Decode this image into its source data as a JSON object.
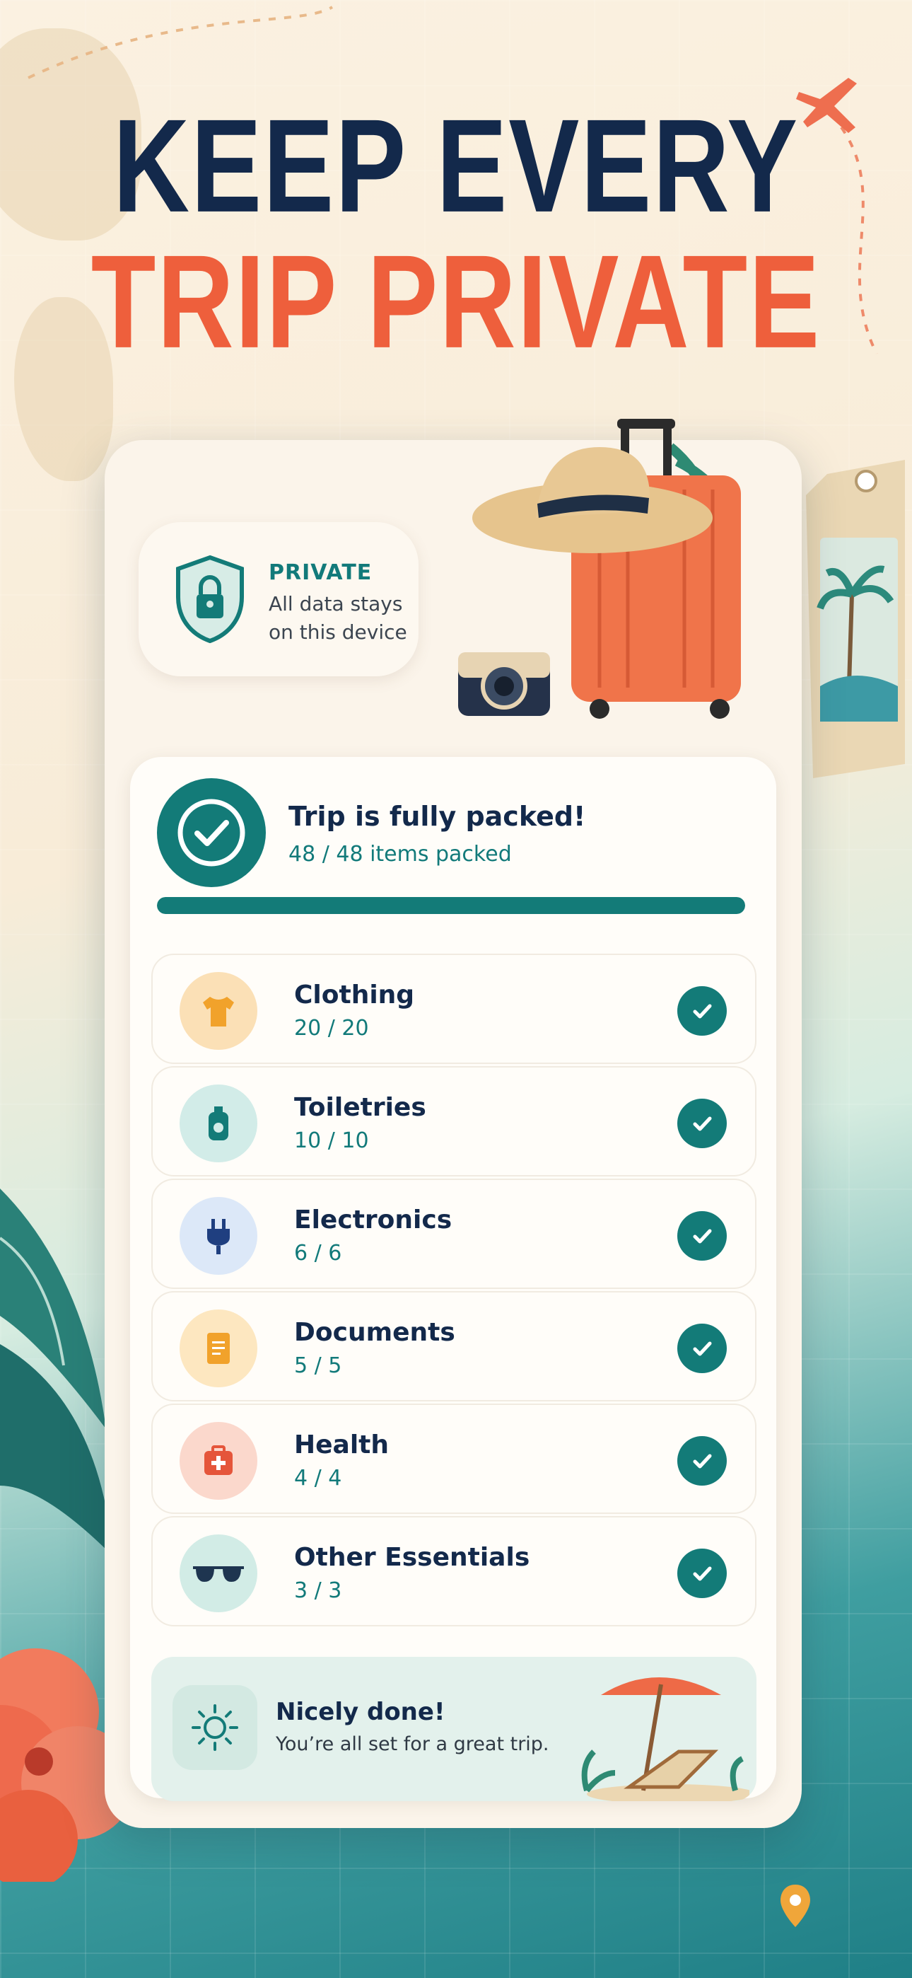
{
  "headline": {
    "line1": "KEEP EVERY",
    "line2": "TRIP PRIVATE"
  },
  "privacy": {
    "title": "PRIVATE",
    "subtitle": "All data stays on this device",
    "icon": "lock-shield-icon"
  },
  "status": {
    "title": "Trip is fully packed!",
    "subtitle": "48 / 48 items packed",
    "progress": 1.0
  },
  "categories": [
    {
      "name": "Clothing",
      "count": "20 / 20",
      "icon": "tshirt-icon",
      "color": "#fbe0b6"
    },
    {
      "name": "Toiletries",
      "count": "10 / 10",
      "icon": "bottle-icon",
      "color": "#d2ece8"
    },
    {
      "name": "Electronics",
      "count": "6 / 6",
      "icon": "plug-icon",
      "color": "#dce8f8"
    },
    {
      "name": "Documents",
      "count": "5 / 5",
      "icon": "document-icon",
      "color": "#fde7c0"
    },
    {
      "name": "Health",
      "count": "4 / 4",
      "icon": "first-aid-icon",
      "color": "#fbd8cc"
    },
    {
      "name": "Other Essentials",
      "count": "3 / 3",
      "icon": "sunglasses-icon",
      "color": "#d2ece6"
    }
  ],
  "completion": {
    "title": "Nicely done!",
    "subtitle": "You’re all set for a great trip."
  },
  "colors": {
    "navy": "#13294b",
    "coral": "#ee5f3c",
    "teal": "#137b78"
  }
}
